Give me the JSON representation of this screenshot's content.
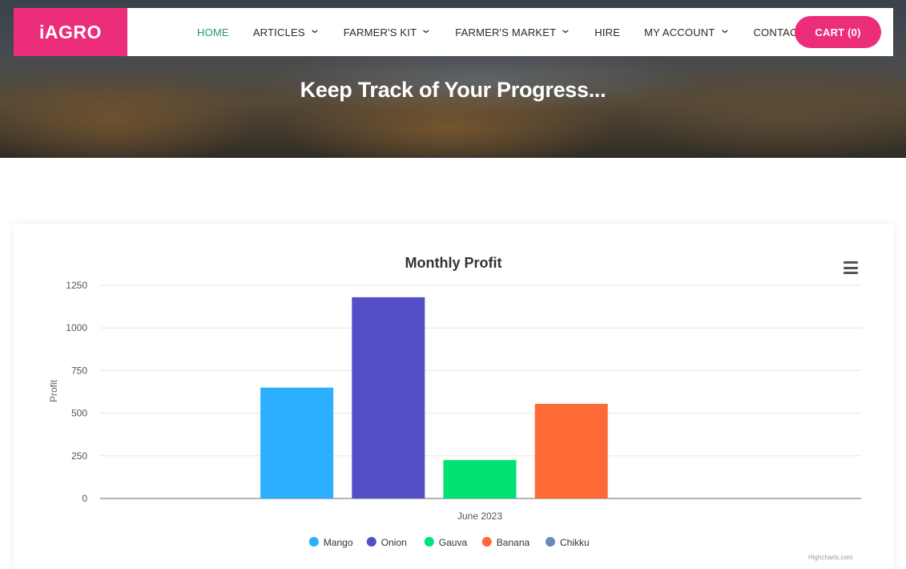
{
  "brand": {
    "logo_text": "iAGRO",
    "accent_color": "#ec2e7a",
    "active_color": "#1e9a6a"
  },
  "nav": {
    "items": [
      {
        "label": "HOME",
        "dropdown": false,
        "active": true
      },
      {
        "label": "ARTICLES",
        "dropdown": true,
        "active": false
      },
      {
        "label": "FARMER'S KIT",
        "dropdown": true,
        "active": false
      },
      {
        "label": "FARMER'S MARKET",
        "dropdown": true,
        "active": false
      },
      {
        "label": "HIRE",
        "dropdown": false,
        "active": false
      },
      {
        "label": "MY ACCOUNT",
        "dropdown": true,
        "active": false
      },
      {
        "label": "CONTACT",
        "dropdown": false,
        "active": false
      }
    ],
    "cart_label": "CART (0)"
  },
  "hero": {
    "title": "Keep Track of Your Progress..."
  },
  "chart_menu_icon": "hamburger-menu-icon",
  "credits": "Highcharts.com",
  "chart_data": {
    "type": "bar",
    "title": "Monthly Profit",
    "xlabel": "",
    "ylabel": "Profit",
    "categories": [
      "June 2023"
    ],
    "ylim": [
      0,
      1250
    ],
    "yticks": [
      0,
      250,
      500,
      750,
      1000,
      1250
    ],
    "grid": true,
    "legend_position": "bottom",
    "series": [
      {
        "name": "Mango",
        "values": [
          650
        ],
        "color": "#2caffe"
      },
      {
        "name": "Onion",
        "values": [
          1180
        ],
        "color": "#544fc5"
      },
      {
        "name": "Gauva",
        "values": [
          225
        ],
        "color": "#00e272"
      },
      {
        "name": "Banana",
        "values": [
          555
        ],
        "color": "#fe6a35"
      },
      {
        "name": "Chikku",
        "values": [
          0
        ],
        "color": "#6b8abc"
      }
    ]
  }
}
